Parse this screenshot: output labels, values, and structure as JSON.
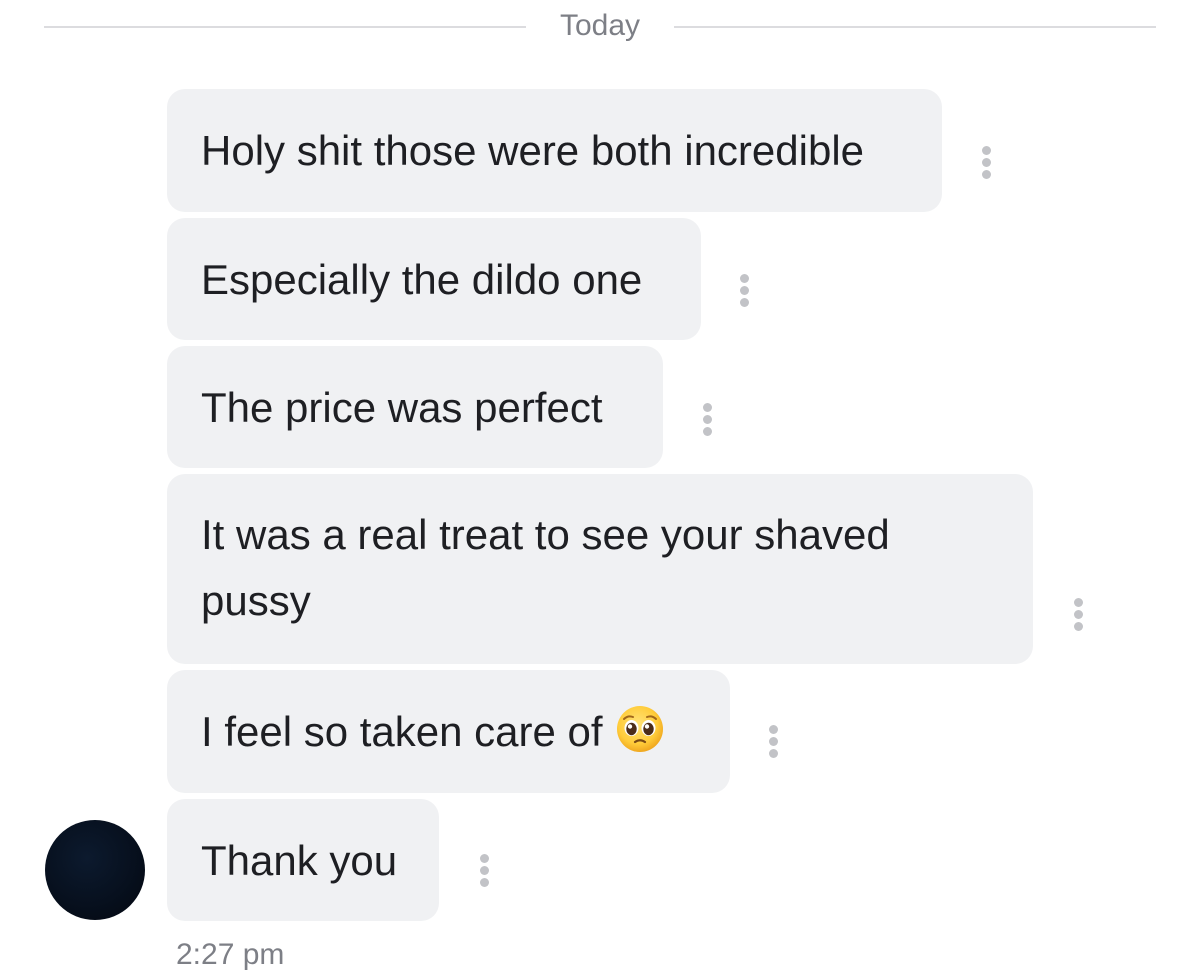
{
  "divider": {
    "label": "Today"
  },
  "messages": [
    {
      "text": "Holy shit those were both incredible"
    },
    {
      "text": "Especially the dildo one"
    },
    {
      "text": "The price was perfect"
    },
    {
      "text": "It was a real treat to see your shaved\npussy"
    },
    {
      "text": "I feel so taken care of",
      "emoji": "pleading-face-emoji"
    },
    {
      "text": "Thank you"
    }
  ],
  "footer": {
    "timestamp": "2:27 pm"
  },
  "icons": {
    "message_options": "more-vertical-icon",
    "sender_avatar": "avatar"
  },
  "colors": {
    "bubble": "#f0f1f3",
    "text": "#1e1f23",
    "muted": "#7d7f86",
    "divider": "#dcdcdf",
    "avatar": "#07101e"
  }
}
